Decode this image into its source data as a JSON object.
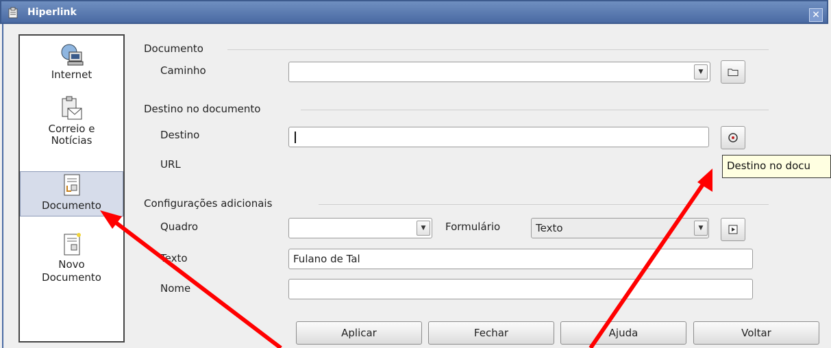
{
  "title": "Hiperlink",
  "sidebar": {
    "items": [
      {
        "label": "Internet",
        "icon": "globe-computer-icon"
      },
      {
        "label": "Correio e\nNotícias",
        "icon": "mail-icon"
      },
      {
        "label": "Documento",
        "icon": "document-icon",
        "selected": true
      },
      {
        "label": "Novo\nDocumento",
        "icon": "new-document-icon"
      }
    ]
  },
  "documento": {
    "section_label": "Documento",
    "caminho_label": "Caminho",
    "caminho_value": ""
  },
  "destino_section": {
    "section_label": "Destino no documento",
    "destino_label": "Destino",
    "destino_value": "",
    "url_label": "URL",
    "tooltip": "Destino no docu"
  },
  "config": {
    "section_label": "Configurações adicionais",
    "quadro_label": "Quadro",
    "quadro_value": "",
    "formulario_label": "Formulário",
    "formulario_value": "Texto",
    "texto_label": "Texto",
    "texto_value": "Fulano de Tal",
    "nome_label": "Nome",
    "nome_value": ""
  },
  "buttons": {
    "apply": "Aplicar",
    "close": "Fechar",
    "help": "Ajuda",
    "back": "Voltar"
  },
  "colors": {
    "titlebar": "#4a6aa3",
    "annotation_arrow": "#ff0000",
    "tooltip_bg": "#ffffe1"
  }
}
